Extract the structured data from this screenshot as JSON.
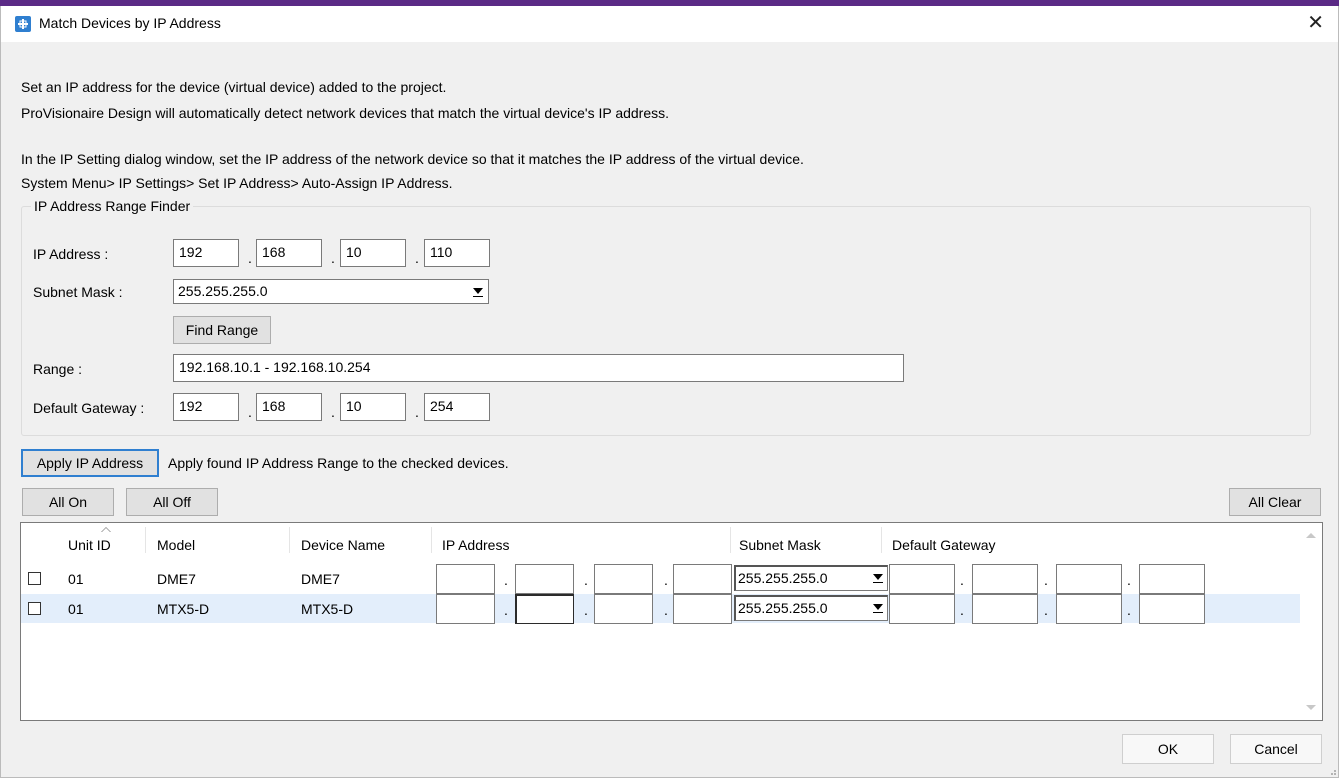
{
  "window": {
    "title": "Match Devices by IP Address",
    "close_glyph": "✕"
  },
  "intro": {
    "line1": "Set an IP address for the device (virtual device) added to the project.",
    "line2": "ProVisionaire Design will automatically detect network devices that match the virtual device's IP address.",
    "line3": "In the IP Setting dialog window, set the IP address of the network device so that it matches the IP address of the virtual device.",
    "line4": "System Menu> IP Settings> Set IP Address> Auto-Assign IP Address."
  },
  "finder": {
    "group_title": "IP Address Range Finder",
    "ip_label": "IP Address :",
    "ip": [
      "192",
      "168",
      "10",
      "110"
    ],
    "subnet_label": "Subnet Mask :",
    "subnet_value": "255.255.255.0",
    "find_range_label": "Find Range",
    "range_label": "Range :",
    "range_value": "192.168.10.1 - 192.168.10.254",
    "gateway_label": "Default Gateway :",
    "gateway": [
      "192",
      "168",
      "10",
      "254"
    ],
    "separator": "."
  },
  "apply": {
    "button_label": "Apply IP Address",
    "description": "Apply found IP Address Range to the checked devices."
  },
  "toolbar": {
    "all_on": "All On",
    "all_off": "All Off",
    "all_clear": "All Clear"
  },
  "table": {
    "columns": [
      "Unit ID",
      "Model",
      "Device Name",
      "IP Address",
      "Subnet Mask",
      "Default Gateway"
    ],
    "rows": [
      {
        "checked": false,
        "unit_id": "01",
        "model": "DME7",
        "device_name": "DME7",
        "subnet_mask": "255.255.255.0"
      },
      {
        "checked": false,
        "unit_id": "01",
        "model": "MTX5-D",
        "device_name": "MTX5-D",
        "subnet_mask": "255.255.255.0"
      }
    ]
  },
  "footer": {
    "ok": "OK",
    "cancel": "Cancel"
  },
  "colors": {
    "accent_bar": "#5b2a86",
    "default_button_border": "#2f7fd0",
    "selected_row": "#e3eefb"
  }
}
